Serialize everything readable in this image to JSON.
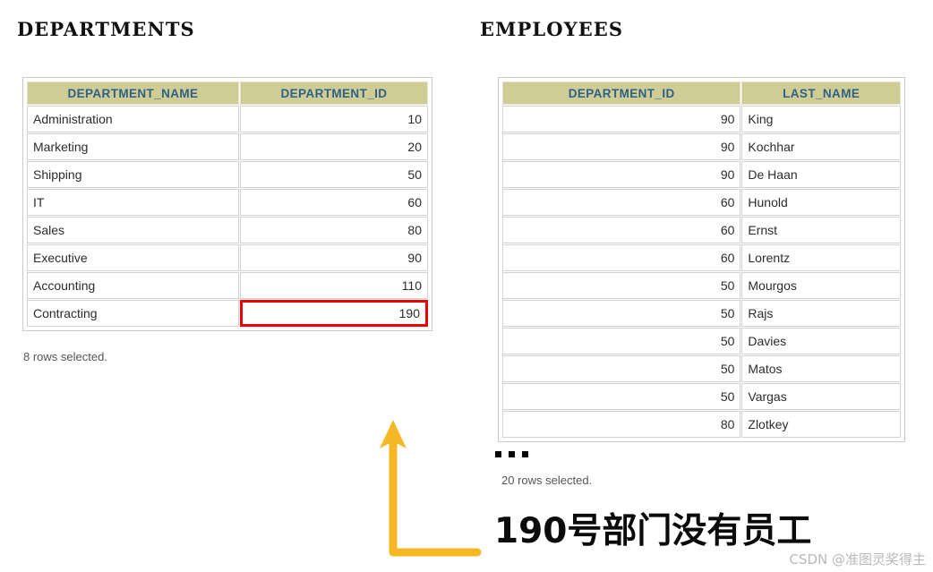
{
  "departments": {
    "title": "DEPARTMENTS",
    "columns": [
      "DEPARTMENT_NAME",
      "DEPARTMENT_ID"
    ],
    "rows": [
      {
        "name": "Administration",
        "id": "10",
        "flagged": false
      },
      {
        "name": "Marketing",
        "id": "20",
        "flagged": false
      },
      {
        "name": "Shipping",
        "id": "50",
        "flagged": false
      },
      {
        "name": "IT",
        "id": "60",
        "flagged": false
      },
      {
        "name": "Sales",
        "id": "80",
        "flagged": false
      },
      {
        "name": "Executive",
        "id": "90",
        "flagged": false
      },
      {
        "name": "Accounting",
        "id": "110",
        "flagged": false
      },
      {
        "name": "Contracting",
        "id": "190",
        "flagged": true
      }
    ],
    "rows_note": "8 rows selected."
  },
  "employees": {
    "title": "EMPLOYEES",
    "columns": [
      "DEPARTMENT_ID",
      "LAST_NAME"
    ],
    "rows": [
      {
        "id": "90",
        "name": "King"
      },
      {
        "id": "90",
        "name": "Kochhar"
      },
      {
        "id": "90",
        "name": "De Haan"
      },
      {
        "id": "60",
        "name": "Hunold"
      },
      {
        "id": "60",
        "name": "Ernst"
      },
      {
        "id": "60",
        "name": "Lorentz"
      },
      {
        "id": "50",
        "name": "Mourgos"
      },
      {
        "id": "50",
        "name": "Rajs"
      },
      {
        "id": "50",
        "name": "Davies"
      },
      {
        "id": "50",
        "name": "Matos"
      },
      {
        "id": "50",
        "name": "Vargas"
      },
      {
        "id": "80",
        "name": "Zlotkey"
      }
    ],
    "truncation_marker": "...",
    "rows_note": "20 rows selected."
  },
  "annotation": {
    "caption": "190号部门没有员工",
    "arrow_color": "#f5b824",
    "highlight_color": "#ee0000"
  },
  "watermark": "CSDN @准图灵奖得主",
  "colors": {
    "header_bg": "#cfcd95",
    "header_text": "#2f6085",
    "cell_border": "#d2d2d2",
    "page_bg": "#ffffff"
  }
}
